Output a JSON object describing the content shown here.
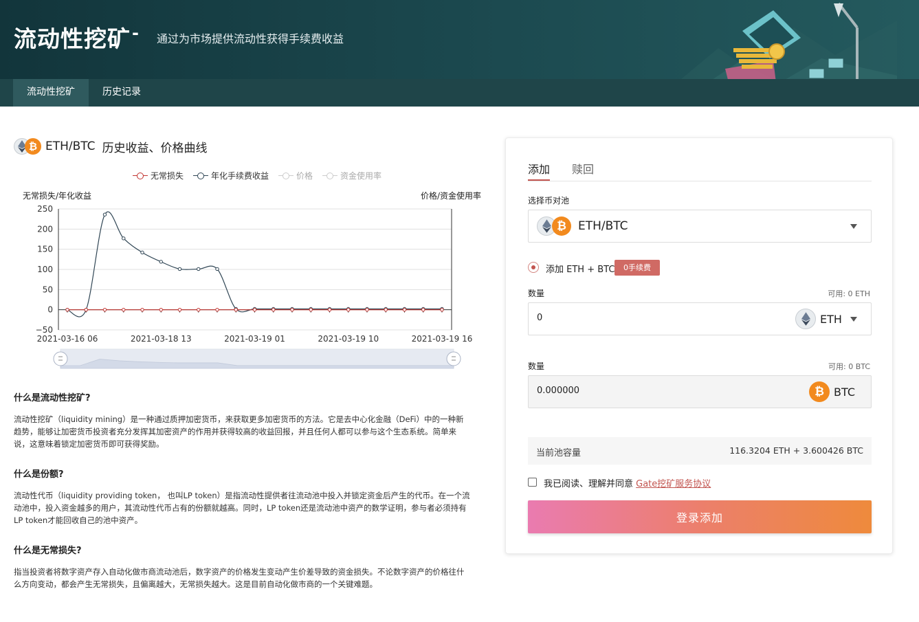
{
  "header": {
    "title": "流动性挖矿",
    "dash": "-",
    "subtitle": "通过为市场提供流动性获得手续费收益"
  },
  "nav": {
    "tabs": [
      {
        "label": "流动性挖矿",
        "active": true
      },
      {
        "label": "历史记录",
        "active": false
      }
    ]
  },
  "pair_header": {
    "pair": "ETH/BTC",
    "title": "历史收益、价格曲线",
    "icons": [
      "ethereum-icon",
      "bitcoin-icon"
    ]
  },
  "chart_data": {
    "type": "line",
    "legend": [
      {
        "name": "无常损失",
        "color": "#c23531",
        "active": true
      },
      {
        "name": "年化手续费收益",
        "color": "#2f4554",
        "active": true
      },
      {
        "name": "价格",
        "color": "#cccccc",
        "active": false
      },
      {
        "name": "资金使用率",
        "color": "#cccccc",
        "active": false
      }
    ],
    "ylabel_left": "无常损失/年化收益",
    "ylabel_right": "价格/资金使用率",
    "ylim": [
      -50,
      250
    ],
    "yticks": [
      "250",
      "200",
      "150",
      "100",
      "50",
      "0",
      "−50"
    ],
    "xticks": [
      "2021-03-16 06",
      "2021-03-18 13",
      "2021-03-19 01",
      "2021-03-19 10",
      "2021-03-19 16"
    ],
    "series": [
      {
        "name": "年化手续费收益",
        "values": [
          0,
          0,
          236,
          177,
          142,
          119,
          101,
          101,
          101,
          2,
          2,
          2,
          2,
          2,
          2,
          2,
          2,
          2,
          2,
          2,
          2
        ]
      },
      {
        "name": "无常损失",
        "values": [
          0,
          0,
          0,
          0,
          0,
          0,
          0,
          0,
          0,
          0,
          0,
          0,
          0,
          0,
          0,
          0,
          0,
          0,
          0,
          0,
          0
        ]
      }
    ],
    "grid": true,
    "data_zoom": {
      "start": 0,
      "end": 100
    }
  },
  "info": [
    {
      "heading": "什么是流动性挖矿?",
      "body": "流动性挖矿（liquidity mining）是一种通过质押加密货币，来获取更多加密货币的方法。它是去中心化金融（DeFi）中的一种新趋势，能够让加密货币投资者充分发挥其加密资产的作用并获得较高的收益回报，并且任何人都可以参与这个生态系统。简单来说，这意味着锁定加密货币即可获得奖励。"
    },
    {
      "heading": "什么是份额?",
      "body": "流动性代币（liquidity providing token， 也叫LP token）是指流动性提供者往流动池中投入并锁定资金后产生的代币。在一个流动池中，投入资金越多的用户，其流动性代币占有的份额就越高。同时，LP token还是流动池中资产的数学证明，参与者必须持有LP token才能回收自己的池中资产。"
    },
    {
      "heading": "什么是无常损失?",
      "body": "指当投资者将数字资产存入自动化做市商流动池后，数字资产的价格发生变动产生价差导致的资金损失。不论数字资产的价格往什么方向变动，都会产生无常损失，且偏离越大，无常损失越大。这是目前自动化做市商的一个关键难题。"
    }
  ],
  "panel": {
    "tabs": [
      "添加",
      "赎回"
    ],
    "pool_label": "选择币对池",
    "pool_value": "ETH/BTC",
    "mode_label": "添加 ETH + BTC",
    "fee_badge": "0手续费",
    "amount1": {
      "label": "数量",
      "available": "可用: 0  ETH",
      "value": "0",
      "coin": "ETH"
    },
    "amount2": {
      "label": "数量",
      "available": "可用: 0  BTC",
      "value": "0.000000",
      "coin": "BTC"
    },
    "capacity_label": "当前池容量",
    "capacity_value": "116.3204 ETH + 3.600426 BTC",
    "agree_text": "我已阅读、理解并同意 ",
    "agree_link": "Gate挖矿服务协议",
    "submit": "登录添加"
  },
  "colors": {
    "header_bg": "#1c4a50",
    "accent": "#c2544f",
    "btn_gradient_start": "#ea7bb0",
    "btn_gradient_end": "#ee8a3c"
  }
}
